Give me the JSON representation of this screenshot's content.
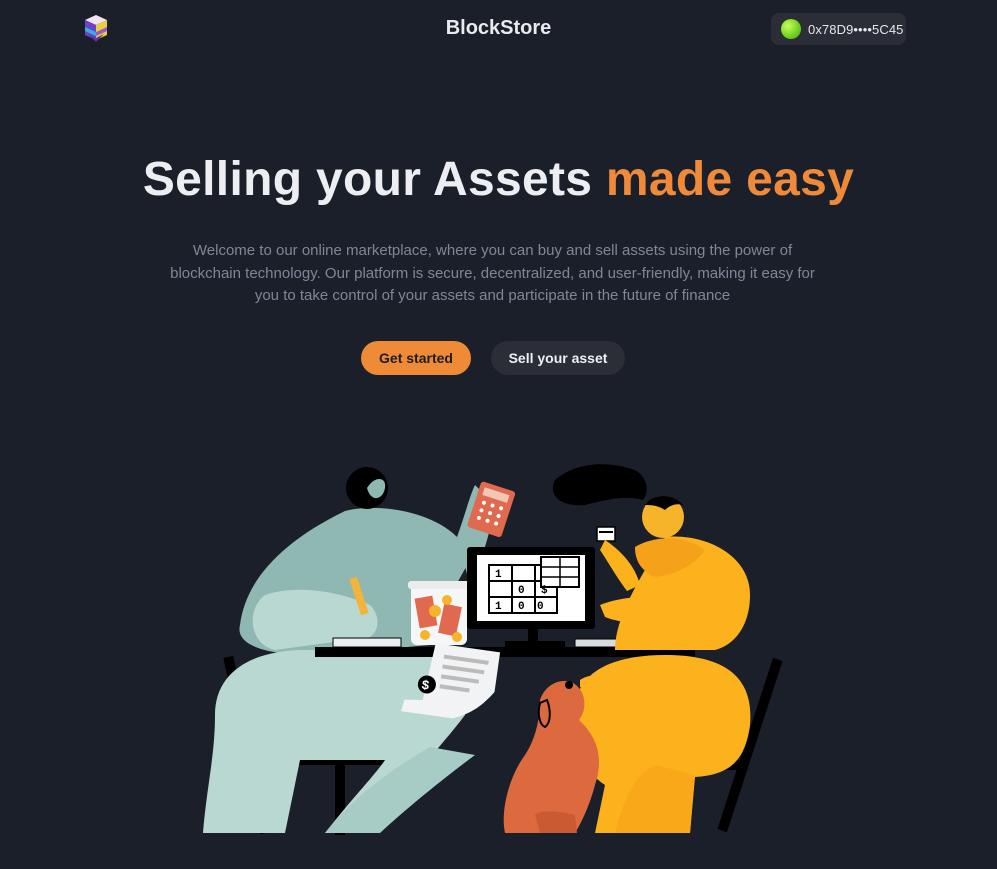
{
  "header": {
    "brand": "BlockStore",
    "logo_icon": "cube-logo-icon",
    "wallet": {
      "address": "0x78D9••••5C45",
      "avatar_icon": "wallet-avatar-icon",
      "avatar_color": "#7ed321"
    }
  },
  "hero": {
    "title_main": "Selling your Assets",
    "title_accent": "made easy",
    "description": "Welcome to our online marketplace, where you can buy and sell assets using the power of blockchain technology. Our platform is secure, decentralized, and user-friendly, making it easy for you to take control of your assets and participate in the future of finance",
    "primary_button": "Get started",
    "secondary_button": "Sell your asset"
  },
  "colors": {
    "background": "#1b1f2a",
    "accent": "#ee8a3a",
    "text": "#eceef2",
    "muted": "#7e8796",
    "surface": "#2b2e37"
  },
  "illustration": {
    "name": "people-working-at-desk-illustration",
    "sheet_numbers": [
      "1",
      "0",
      "$",
      "1",
      "0",
      "0"
    ],
    "receipt_symbol": "$"
  }
}
